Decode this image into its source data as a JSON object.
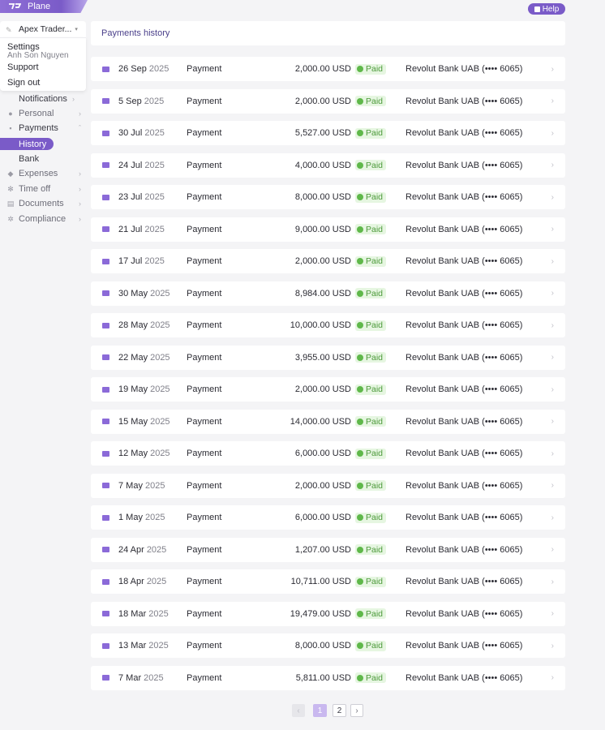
{
  "app": {
    "brand": "Plane",
    "help_label": "Help"
  },
  "account": {
    "company": "Apex Trader...",
    "menu": {
      "settings": "Settings",
      "user_name": "Anh Son Nguyen",
      "support": "Support",
      "sign_out": "Sign out"
    }
  },
  "sidebar": {
    "notifications": "Notifications",
    "personal": "Personal",
    "payments": "Payments",
    "history": "History",
    "bank": "Bank",
    "expenses": "Expenses",
    "time_off": "Time off",
    "documents": "Documents",
    "compliance": "Compliance"
  },
  "main": {
    "title": "Payments history",
    "rows": [
      {
        "day": "26 Sep",
        "year": "2025",
        "type": "Payment",
        "amount": "2,000.00 USD",
        "status": "Paid",
        "bank": "Revolut Bank UAB (•••• 6065)"
      },
      {
        "day": "5 Sep",
        "year": "2025",
        "type": "Payment",
        "amount": "2,000.00 USD",
        "status": "Paid",
        "bank": "Revolut Bank UAB (•••• 6065)"
      },
      {
        "day": "30 Jul",
        "year": "2025",
        "type": "Payment",
        "amount": "5,527.00 USD",
        "status": "Paid",
        "bank": "Revolut Bank UAB (•••• 6065)"
      },
      {
        "day": "24 Jul",
        "year": "2025",
        "type": "Payment",
        "amount": "4,000.00 USD",
        "status": "Paid",
        "bank": "Revolut Bank UAB (•••• 6065)"
      },
      {
        "day": "23 Jul",
        "year": "2025",
        "type": "Payment",
        "amount": "8,000.00 USD",
        "status": "Paid",
        "bank": "Revolut Bank UAB (•••• 6065)"
      },
      {
        "day": "21 Jul",
        "year": "2025",
        "type": "Payment",
        "amount": "9,000.00 USD",
        "status": "Paid",
        "bank": "Revolut Bank UAB (•••• 6065)"
      },
      {
        "day": "17 Jul",
        "year": "2025",
        "type": "Payment",
        "amount": "2,000.00 USD",
        "status": "Paid",
        "bank": "Revolut Bank UAB (•••• 6065)"
      },
      {
        "day": "30 May",
        "year": "2025",
        "type": "Payment",
        "amount": "8,984.00 USD",
        "status": "Paid",
        "bank": "Revolut Bank UAB (•••• 6065)"
      },
      {
        "day": "28 May",
        "year": "2025",
        "type": "Payment",
        "amount": "10,000.00 USD",
        "status": "Paid",
        "bank": "Revolut Bank UAB (•••• 6065)"
      },
      {
        "day": "22 May",
        "year": "2025",
        "type": "Payment",
        "amount": "3,955.00 USD",
        "status": "Paid",
        "bank": "Revolut Bank UAB (•••• 6065)"
      },
      {
        "day": "19 May",
        "year": "2025",
        "type": "Payment",
        "amount": "2,000.00 USD",
        "status": "Paid",
        "bank": "Revolut Bank UAB (•••• 6065)"
      },
      {
        "day": "15 May",
        "year": "2025",
        "type": "Payment",
        "amount": "14,000.00 USD",
        "status": "Paid",
        "bank": "Revolut Bank UAB (•••• 6065)"
      },
      {
        "day": "12 May",
        "year": "2025",
        "type": "Payment",
        "amount": "6,000.00 USD",
        "status": "Paid",
        "bank": "Revolut Bank UAB (•••• 6065)"
      },
      {
        "day": "7 May",
        "year": "2025",
        "type": "Payment",
        "amount": "2,000.00 USD",
        "status": "Paid",
        "bank": "Revolut Bank UAB (•••• 6065)"
      },
      {
        "day": "1 May",
        "year": "2025",
        "type": "Payment",
        "amount": "6,000.00 USD",
        "status": "Paid",
        "bank": "Revolut Bank UAB (•••• 6065)"
      },
      {
        "day": "24 Apr",
        "year": "2025",
        "type": "Payment",
        "amount": "1,207.00 USD",
        "status": "Paid",
        "bank": "Revolut Bank UAB (•••• 6065)"
      },
      {
        "day": "18 Apr",
        "year": "2025",
        "type": "Payment",
        "amount": "10,711.00 USD",
        "status": "Paid",
        "bank": "Revolut Bank UAB (•••• 6065)"
      },
      {
        "day": "18 Mar",
        "year": "2025",
        "type": "Payment",
        "amount": "19,479.00 USD",
        "status": "Paid",
        "bank": "Revolut Bank UAB (•••• 6065)"
      },
      {
        "day": "13 Mar",
        "year": "2025",
        "type": "Payment",
        "amount": "8,000.00 USD",
        "status": "Paid",
        "bank": "Revolut Bank UAB (•••• 6065)"
      },
      {
        "day": "7 Mar",
        "year": "2025",
        "type": "Payment",
        "amount": "5,811.00 USD",
        "status": "Paid",
        "bank": "Revolut Bank UAB (•••• 6065)"
      }
    ]
  },
  "pagination": {
    "prev": "‹",
    "pages": [
      "1",
      "2"
    ],
    "current": "1",
    "next": "›"
  },
  "colors": {
    "accent": "#7a5bc8",
    "paid_bg": "#e6f6e1",
    "paid_text": "#4d9a3b"
  }
}
